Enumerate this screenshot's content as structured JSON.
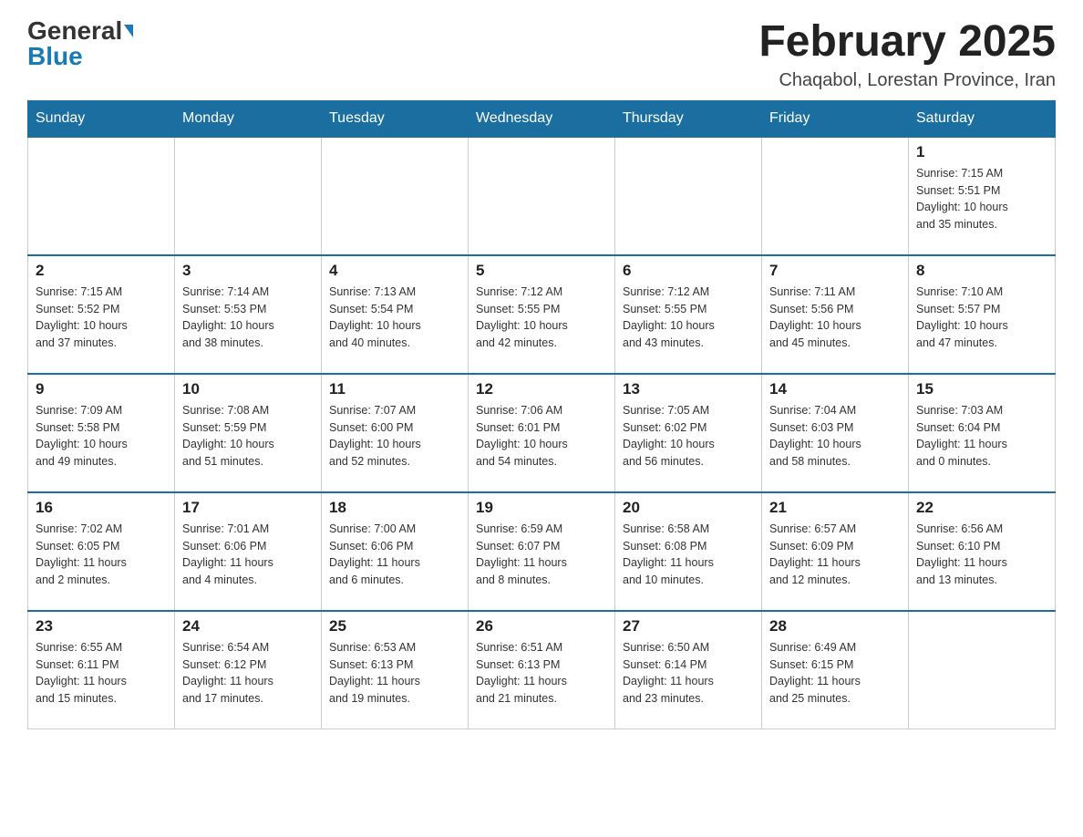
{
  "header": {
    "logo_general": "General",
    "logo_blue": "Blue",
    "month_title": "February 2025",
    "location": "Chaqabol, Lorestan Province, Iran"
  },
  "days_of_week": [
    "Sunday",
    "Monday",
    "Tuesday",
    "Wednesday",
    "Thursday",
    "Friday",
    "Saturday"
  ],
  "weeks": [
    {
      "days": [
        {
          "number": "",
          "info": ""
        },
        {
          "number": "",
          "info": ""
        },
        {
          "number": "",
          "info": ""
        },
        {
          "number": "",
          "info": ""
        },
        {
          "number": "",
          "info": ""
        },
        {
          "number": "",
          "info": ""
        },
        {
          "number": "1",
          "info": "Sunrise: 7:15 AM\nSunset: 5:51 PM\nDaylight: 10 hours\nand 35 minutes."
        }
      ]
    },
    {
      "days": [
        {
          "number": "2",
          "info": "Sunrise: 7:15 AM\nSunset: 5:52 PM\nDaylight: 10 hours\nand 37 minutes."
        },
        {
          "number": "3",
          "info": "Sunrise: 7:14 AM\nSunset: 5:53 PM\nDaylight: 10 hours\nand 38 minutes."
        },
        {
          "number": "4",
          "info": "Sunrise: 7:13 AM\nSunset: 5:54 PM\nDaylight: 10 hours\nand 40 minutes."
        },
        {
          "number": "5",
          "info": "Sunrise: 7:12 AM\nSunset: 5:55 PM\nDaylight: 10 hours\nand 42 minutes."
        },
        {
          "number": "6",
          "info": "Sunrise: 7:12 AM\nSunset: 5:55 PM\nDaylight: 10 hours\nand 43 minutes."
        },
        {
          "number": "7",
          "info": "Sunrise: 7:11 AM\nSunset: 5:56 PM\nDaylight: 10 hours\nand 45 minutes."
        },
        {
          "number": "8",
          "info": "Sunrise: 7:10 AM\nSunset: 5:57 PM\nDaylight: 10 hours\nand 47 minutes."
        }
      ]
    },
    {
      "days": [
        {
          "number": "9",
          "info": "Sunrise: 7:09 AM\nSunset: 5:58 PM\nDaylight: 10 hours\nand 49 minutes."
        },
        {
          "number": "10",
          "info": "Sunrise: 7:08 AM\nSunset: 5:59 PM\nDaylight: 10 hours\nand 51 minutes."
        },
        {
          "number": "11",
          "info": "Sunrise: 7:07 AM\nSunset: 6:00 PM\nDaylight: 10 hours\nand 52 minutes."
        },
        {
          "number": "12",
          "info": "Sunrise: 7:06 AM\nSunset: 6:01 PM\nDaylight: 10 hours\nand 54 minutes."
        },
        {
          "number": "13",
          "info": "Sunrise: 7:05 AM\nSunset: 6:02 PM\nDaylight: 10 hours\nand 56 minutes."
        },
        {
          "number": "14",
          "info": "Sunrise: 7:04 AM\nSunset: 6:03 PM\nDaylight: 10 hours\nand 58 minutes."
        },
        {
          "number": "15",
          "info": "Sunrise: 7:03 AM\nSunset: 6:04 PM\nDaylight: 11 hours\nand 0 minutes."
        }
      ]
    },
    {
      "days": [
        {
          "number": "16",
          "info": "Sunrise: 7:02 AM\nSunset: 6:05 PM\nDaylight: 11 hours\nand 2 minutes."
        },
        {
          "number": "17",
          "info": "Sunrise: 7:01 AM\nSunset: 6:06 PM\nDaylight: 11 hours\nand 4 minutes."
        },
        {
          "number": "18",
          "info": "Sunrise: 7:00 AM\nSunset: 6:06 PM\nDaylight: 11 hours\nand 6 minutes."
        },
        {
          "number": "19",
          "info": "Sunrise: 6:59 AM\nSunset: 6:07 PM\nDaylight: 11 hours\nand 8 minutes."
        },
        {
          "number": "20",
          "info": "Sunrise: 6:58 AM\nSunset: 6:08 PM\nDaylight: 11 hours\nand 10 minutes."
        },
        {
          "number": "21",
          "info": "Sunrise: 6:57 AM\nSunset: 6:09 PM\nDaylight: 11 hours\nand 12 minutes."
        },
        {
          "number": "22",
          "info": "Sunrise: 6:56 AM\nSunset: 6:10 PM\nDaylight: 11 hours\nand 13 minutes."
        }
      ]
    },
    {
      "days": [
        {
          "number": "23",
          "info": "Sunrise: 6:55 AM\nSunset: 6:11 PM\nDaylight: 11 hours\nand 15 minutes."
        },
        {
          "number": "24",
          "info": "Sunrise: 6:54 AM\nSunset: 6:12 PM\nDaylight: 11 hours\nand 17 minutes."
        },
        {
          "number": "25",
          "info": "Sunrise: 6:53 AM\nSunset: 6:13 PM\nDaylight: 11 hours\nand 19 minutes."
        },
        {
          "number": "26",
          "info": "Sunrise: 6:51 AM\nSunset: 6:13 PM\nDaylight: 11 hours\nand 21 minutes."
        },
        {
          "number": "27",
          "info": "Sunrise: 6:50 AM\nSunset: 6:14 PM\nDaylight: 11 hours\nand 23 minutes."
        },
        {
          "number": "28",
          "info": "Sunrise: 6:49 AM\nSunset: 6:15 PM\nDaylight: 11 hours\nand 25 minutes."
        },
        {
          "number": "",
          "info": ""
        }
      ]
    }
  ]
}
